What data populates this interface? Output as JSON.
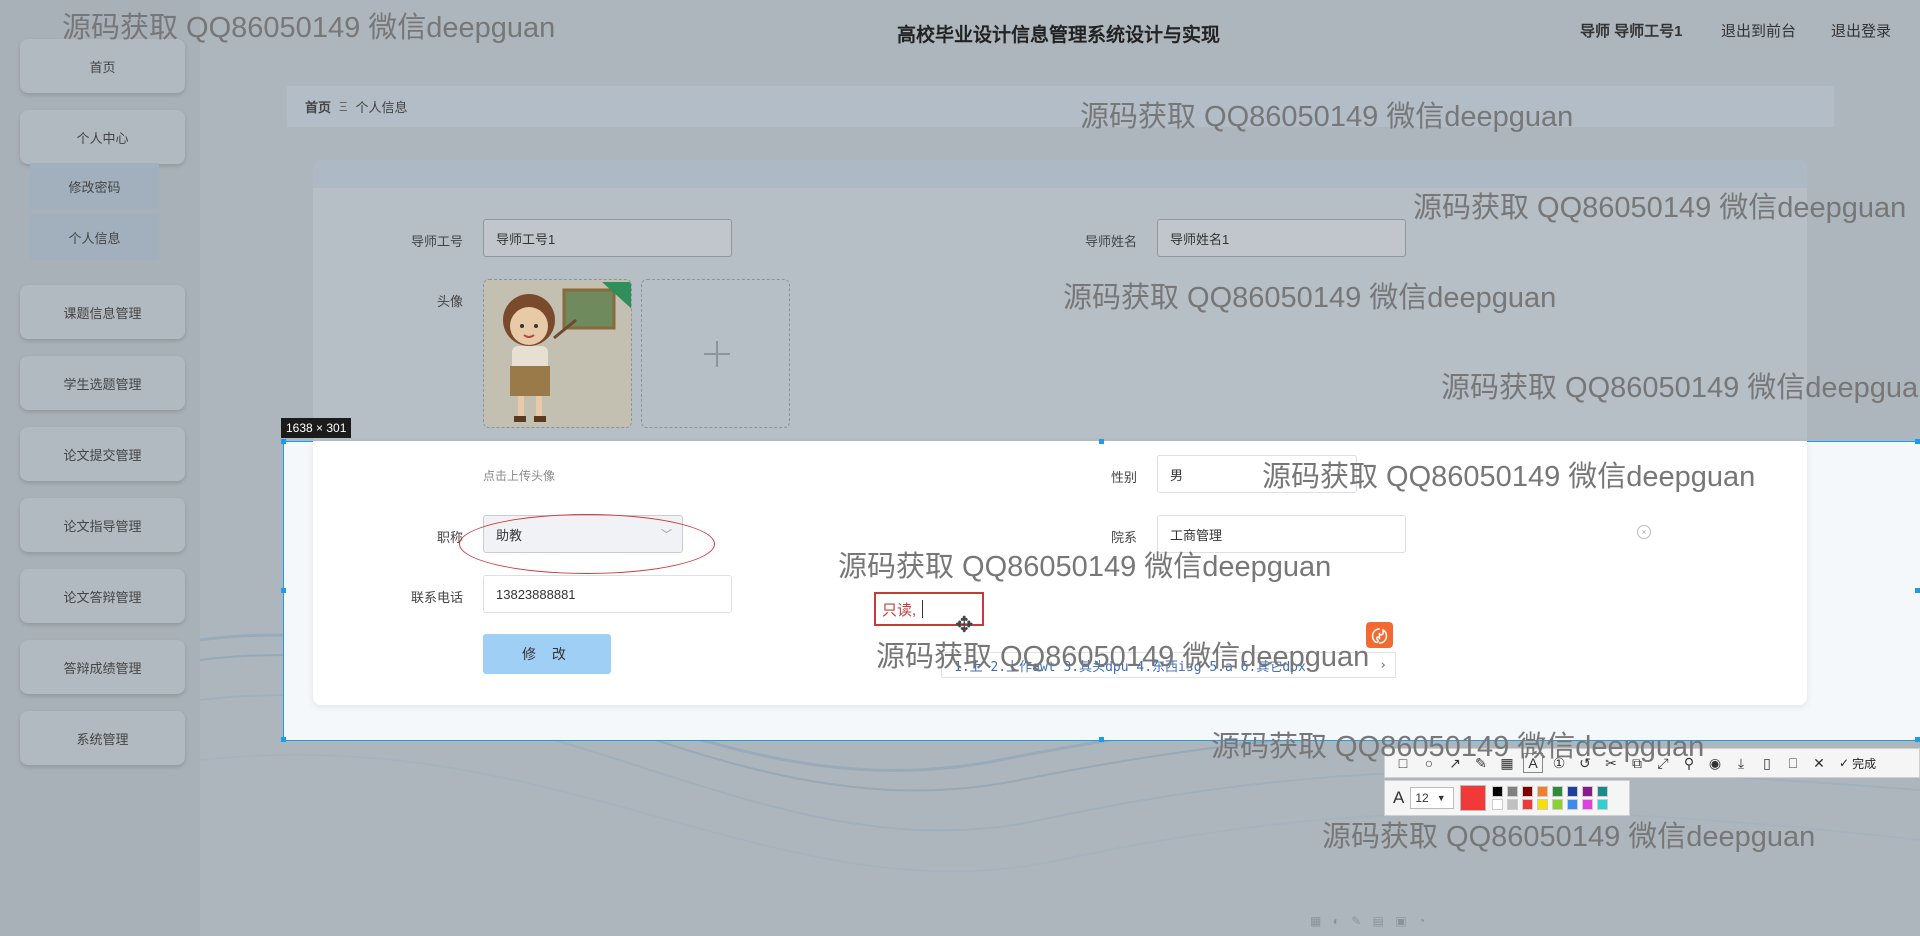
{
  "header": {
    "title": "高校毕业设计信息管理系统设计与实现",
    "user_label": "导师 导师工号1",
    "back_to_front": "退出到前台",
    "logout": "退出登录"
  },
  "sidebar": {
    "items": [
      {
        "label": "首页"
      },
      {
        "label": "个人中心"
      },
      {
        "label": "课题信息管理"
      },
      {
        "label": "学生选题管理"
      },
      {
        "label": "论文提交管理"
      },
      {
        "label": "论文指导管理"
      },
      {
        "label": "论文答辩管理"
      },
      {
        "label": "答辩成绩管理"
      },
      {
        "label": "系统管理"
      }
    ],
    "sub_items": [
      {
        "label": "修改密码"
      },
      {
        "label": "个人信息"
      }
    ]
  },
  "breadcrumb": {
    "home": "首页",
    "separator": "Ξ",
    "current": "个人信息"
  },
  "form": {
    "tutor_id_label": "导师工号",
    "tutor_id_value": "导师工号1",
    "tutor_name_label": "导师姓名",
    "tutor_name_value": "导师姓名1",
    "avatar_label": "头像",
    "upload_hint": "点击上传头像",
    "gender_label": "性别",
    "gender_value": "男",
    "title_label": "职称",
    "title_value": "助教",
    "department_label": "院系",
    "department_value": "工商管理",
    "phone_label": "联系电话",
    "phone_value": "13823888881",
    "submit_label": "修 改"
  },
  "screenshot_tool": {
    "size_label": "1638 × 301",
    "annotation_text": "只读,",
    "ime_candidates": "1.上  2.上作awt  3.其头dpu  4.东西isg  5.a  6.其它dpx",
    "font_size": "12",
    "done_label": "完成",
    "accent_color": "#f03a3a",
    "selection_color": "#1e9ce8"
  },
  "watermark": "源码获取 QQ86050149 微信deepguan",
  "colors": {
    "primary_button": "#a0cff5",
    "card": "#ffffff",
    "overlay": "#aeb6bd"
  }
}
